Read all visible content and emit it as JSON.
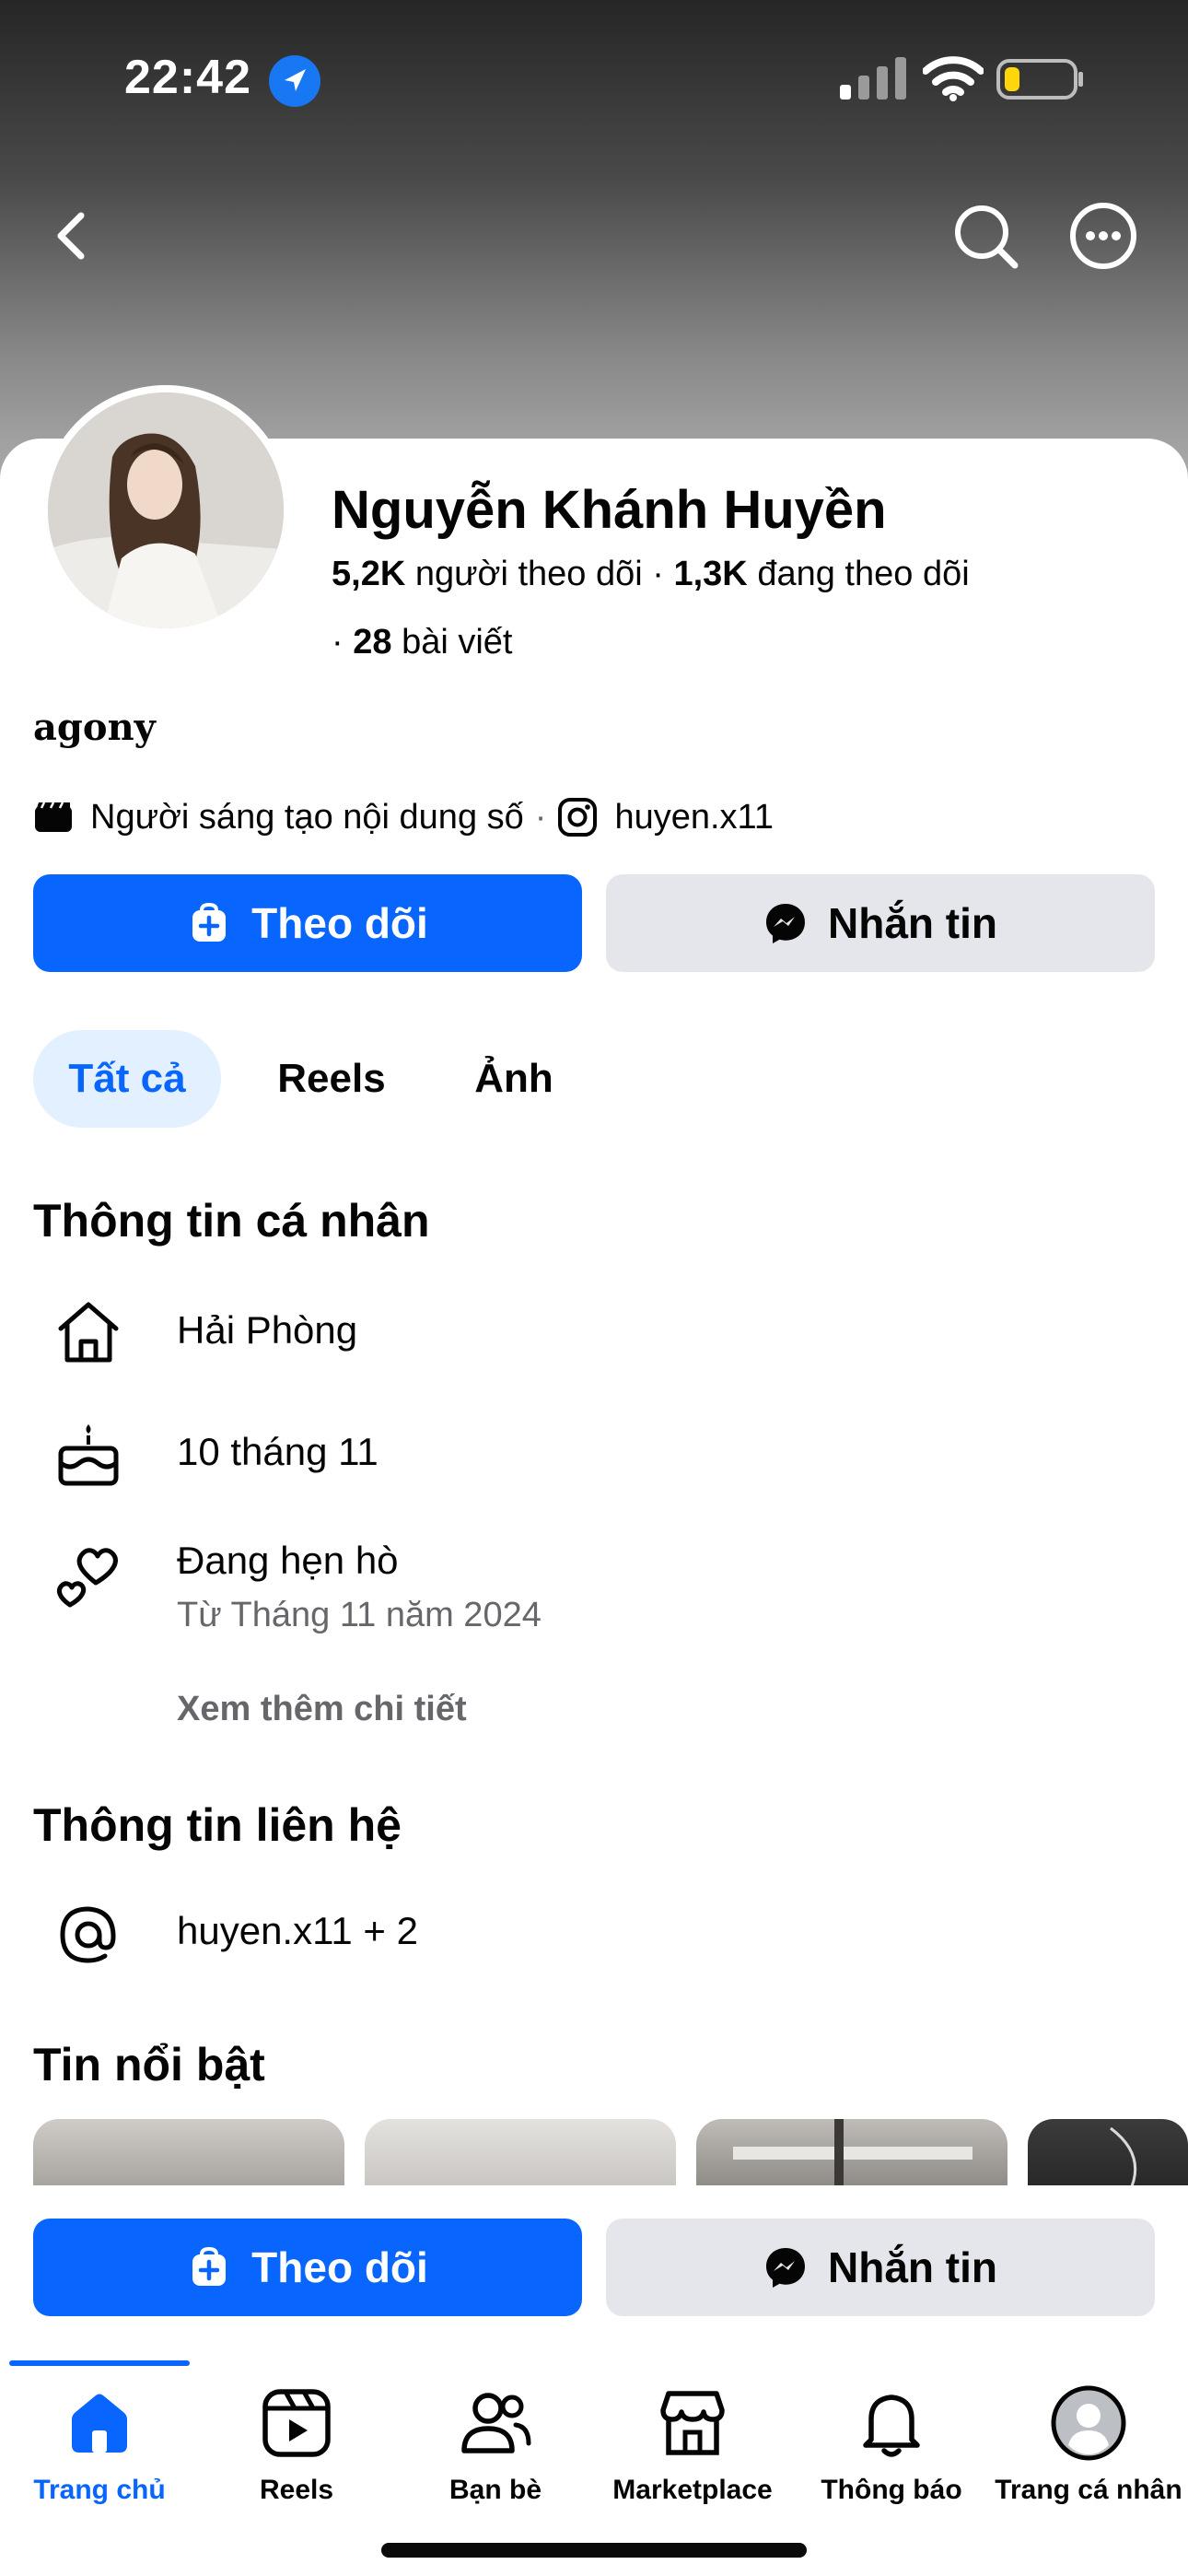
{
  "status_bar": {
    "time": "22:42"
  },
  "profile": {
    "name": "Nguyễn Khánh Huyền",
    "followers_count": "5,2K",
    "followers_label": "người theo dõi",
    "following_count": "1,3K",
    "following_label": "đang theo dõi",
    "posts_prefix": "·",
    "posts_count": "28",
    "posts_label": "bài viết",
    "bio": "agony",
    "category": "Người sáng tạo nội dung số",
    "separator": "·",
    "instagram": "huyen.x11"
  },
  "actions": {
    "follow_label": "Theo dõi",
    "message_label": "Nhắn tin"
  },
  "tabs": [
    {
      "label": "Tất cả"
    },
    {
      "label": "Reels"
    },
    {
      "label": "Ảnh"
    }
  ],
  "personal_info": {
    "title": "Thông tin cá nhân",
    "hometown": "Hải Phòng",
    "birthday": "10 tháng 11",
    "relationship": "Đang hẹn hò",
    "relationship_since": "Từ Tháng 11 năm 2024",
    "see_more": "Xem thêm chi tiết"
  },
  "contact_info": {
    "title": "Thông tin liên hệ",
    "value": "huyen.x11 + 2"
  },
  "highlights": {
    "title": "Tin nổi bật"
  },
  "bottom_nav": [
    {
      "label": "Trang chủ",
      "icon": "home-icon",
      "active": true
    },
    {
      "label": "Reels",
      "icon": "reels-icon"
    },
    {
      "label": "Bạn bè",
      "icon": "friends-icon"
    },
    {
      "label": "Marketplace",
      "icon": "marketplace-icon"
    },
    {
      "label": "Thông báo",
      "icon": "bell-icon"
    },
    {
      "label": "Trang cá nhân",
      "icon": "profile-icon"
    }
  ],
  "colors": {
    "accent": "#0866ff",
    "secondary_button": "#e4e6eb",
    "muted_text": "#65676b"
  }
}
